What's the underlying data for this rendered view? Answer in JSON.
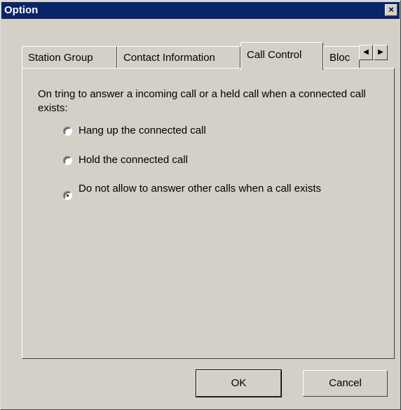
{
  "window": {
    "title": "Option",
    "close_symbol": "×"
  },
  "tabs": [
    {
      "label": "Station Group"
    },
    {
      "label": "Contact Information"
    },
    {
      "label": "Call Control"
    },
    {
      "label": "Bloc"
    }
  ],
  "active_tab": "Call Control",
  "tab_scroll": {
    "left": "◀",
    "right": "▶"
  },
  "call_control": {
    "prompt": "On tring to answer a incoming call or a held call when a connected call exists:",
    "options": [
      {
        "label": "Hang up the connected call",
        "checked": false
      },
      {
        "label": "Hold the connected call",
        "checked": false
      },
      {
        "label": "Do not allow to answer other calls when a call exists",
        "checked": true
      }
    ]
  },
  "buttons": {
    "ok": "OK",
    "cancel": "Cancel"
  },
  "colors": {
    "title_bar": "#0a246a",
    "face": "#d4d0c8"
  }
}
